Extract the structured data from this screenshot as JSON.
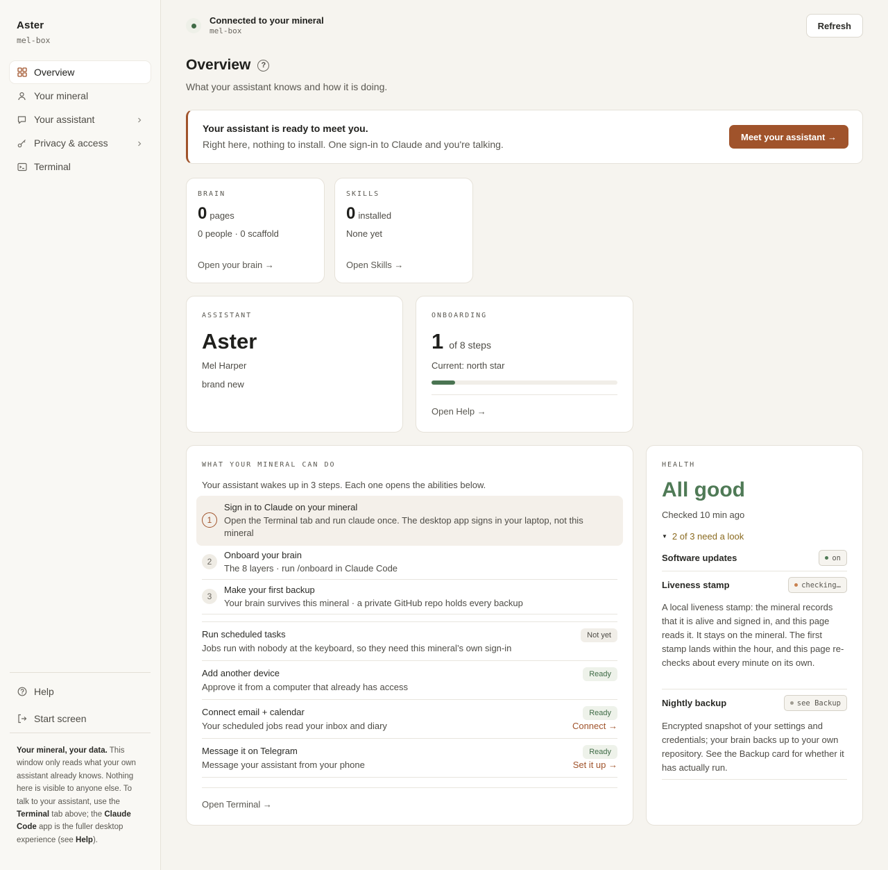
{
  "sidebar": {
    "brand_name": "Aster",
    "brand_host": "mel-box",
    "nav": [
      {
        "label": "Overview",
        "icon": "grid-icon",
        "active": true
      },
      {
        "label": "Your mineral",
        "icon": "person-icon"
      },
      {
        "label": "Your assistant",
        "icon": "chat-icon",
        "chevron": true
      },
      {
        "label": "Privacy & access",
        "icon": "key-icon",
        "chevron": true
      },
      {
        "label": "Terminal",
        "icon": "terminal-icon"
      }
    ],
    "bottom": [
      {
        "label": "Help",
        "icon": "help-circle-icon"
      },
      {
        "label": "Start screen",
        "icon": "exit-icon"
      }
    ],
    "note": {
      "lead": "Your mineral, your data.",
      "p1": " This window only reads what your own assistant already knows. Nothing here is visible to anyone else. To talk to your assistant, use the ",
      "terminal": "Terminal",
      "p2": " tab above; the ",
      "claude_code": "Claude Code",
      "p3": " app is the fuller desktop experience (see ",
      "help": "Help",
      "p4": ")."
    }
  },
  "topbar": {
    "connection_title": "Connected to your mineral",
    "connection_host": "mel-box",
    "refresh_label": "Refresh"
  },
  "page": {
    "title": "Overview",
    "help_glyph": "?",
    "subtitle": "What your assistant knows and how it is doing."
  },
  "banner": {
    "title": "Your assistant is ready to meet you.",
    "subtitle": "Right here, nothing to install. One sign-in to Claude and you're talking.",
    "button_label": "Meet your assistant →"
  },
  "brain": {
    "eyebrow": "BRAIN",
    "value": "0",
    "unit": "pages",
    "detail": "0 people · 0 scaffold",
    "link": "Open your brain →"
  },
  "skills": {
    "eyebrow": "SKILLS",
    "value": "0",
    "unit": "installed",
    "detail": "None yet",
    "link": "Open Skills →"
  },
  "assistant": {
    "eyebrow": "ASSISTANT",
    "name": "Aster",
    "owner": "Mel Harper",
    "status": "brand new"
  },
  "onboarding": {
    "eyebrow": "ONBOARDING",
    "value": "1",
    "unit": "of 8 steps",
    "current": "Current: north star",
    "progress_fraction": 0.125,
    "link": "Open Help →"
  },
  "abilities": {
    "eyebrow": "WHAT YOUR MINERAL CAN DO",
    "intro": "Your assistant wakes up in 3 steps. Each one opens the abilities below.",
    "steps": [
      {
        "num": "1",
        "title": "Sign in to Claude on your mineral",
        "desc": "Open the Terminal tab and run claude once. The desktop app signs in your laptop, not this mineral"
      },
      {
        "num": "2",
        "title": "Onboard your brain",
        "desc": "The 8 layers · run /onboard in Claude Code"
      },
      {
        "num": "3",
        "title": "Make your first backup",
        "desc": "Your brain survives this mineral · a private GitHub repo holds every backup"
      }
    ],
    "items": [
      {
        "title": "Run scheduled tasks",
        "desc": "Jobs run with nobody at the keyboard, so they need this mineral’s own sign-in",
        "badge": "Not yet"
      },
      {
        "title": "Add another device",
        "desc": "Approve it from a computer that already has access",
        "badge": "Ready"
      },
      {
        "title": "Connect email + calendar",
        "desc": "Your scheduled jobs read your inbox and diary",
        "badge": "Ready",
        "link": "Connect →"
      },
      {
        "title": "Message it on Telegram",
        "desc": "Message your assistant from your phone",
        "badge": "Ready",
        "link": "Set it up →"
      }
    ],
    "footer_link": "Open Terminal →"
  },
  "health": {
    "eyebrow": "HEALTH",
    "status": "All good",
    "checked": "Checked 10 min ago",
    "attention": "2 of 3 need a look",
    "software_updates": {
      "title": "Software updates",
      "pill": "on"
    },
    "liveness": {
      "title": "Liveness stamp",
      "pill": "checking…",
      "desc": "A local liveness stamp: the mineral records that it is alive and signed in, and this page reads it. It stays on the mineral. The first stamp lands within the hour, and this page re-checks about every minute on its own."
    },
    "backup": {
      "title": "Nightly backup",
      "pill": "see Backup",
      "desc": "Encrypted snapshot of your settings and credentials; your brain backs up to your own repository. See the Backup card for whether it has actually run."
    }
  },
  "colors": {
    "accent": "#a0532b",
    "good": "#3f6b46",
    "background": "#f6f4ef",
    "warning_text": "#8a6a1f"
  }
}
